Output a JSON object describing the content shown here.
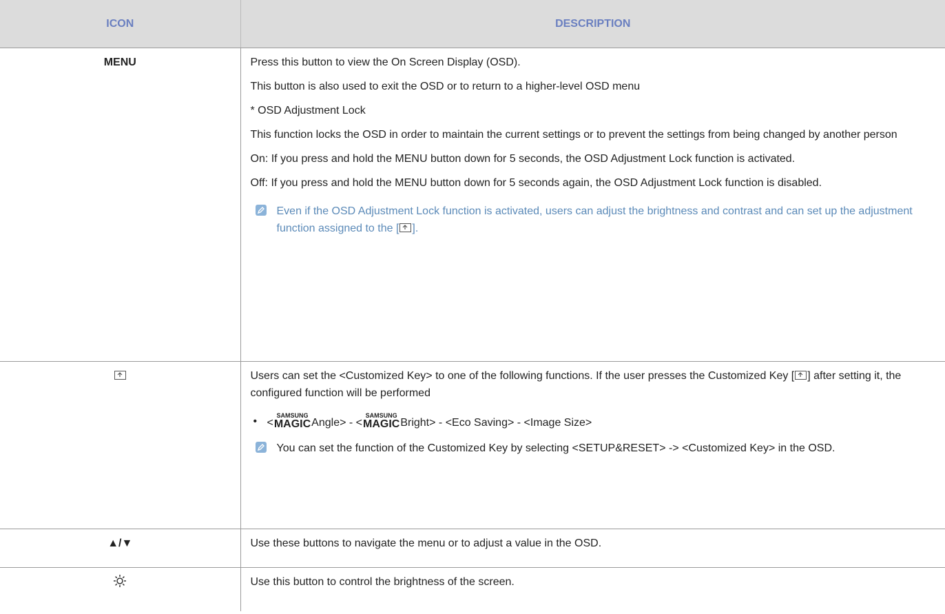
{
  "header": {
    "icon": "ICON",
    "description": "DESCRIPTION"
  },
  "rows": {
    "menu": {
      "icon_label": "MENU",
      "p1": "Press this button to view the On Screen Display (OSD).",
      "p2": "This button is also used to exit the OSD or to return to a higher-level OSD menu",
      "p3": "* OSD Adjustment Lock",
      "p4": "This function locks the OSD in order to maintain the current settings or to prevent the settings from being changed by another person",
      "p5": "On: If you press and hold the MENU button down for 5 seconds, the OSD Adjustment Lock function is activated.",
      "p6": "Off: If you press and hold the MENU button down for 5 seconds again, the OSD Adjustment Lock function is disabled.",
      "note_before": "Even if the OSD Adjustment Lock function is activated, users can adjust the brightness and contrast and can set up the adjustment function assigned to the [",
      "note_after": "]."
    },
    "customized": {
      "icon_name": "customized-key-icon",
      "p1_before": "Users can set the <Customized Key> to one of the following functions. If the user presses the Customized Key [",
      "p1_after": "] after setting it, the configured function will be performed",
      "bullet": "•",
      "logo_top": "SAMSUNG",
      "logo_bottom": "MAGIC",
      "b1": "<",
      "b2": "Angle> - <",
      "b3": "Bright> - <Eco Saving> - <Image Size>",
      "note": "You can set the function of the Customized Key by selecting <SETUP&RESET> -> <Customized Key> in the OSD."
    },
    "arrows": {
      "icon_label": "▲/▼",
      "description": "Use these buttons to navigate the menu or to adjust a value in the OSD."
    },
    "brightness": {
      "icon_name": "brightness-icon",
      "description": "Use this button to control the brightness of the screen."
    }
  },
  "colors": {
    "header_bg": "#dcdcdc",
    "header_text": "#6a7fc0",
    "note_text": "#5b8ab8",
    "note_icon": "#8bb3d9"
  }
}
